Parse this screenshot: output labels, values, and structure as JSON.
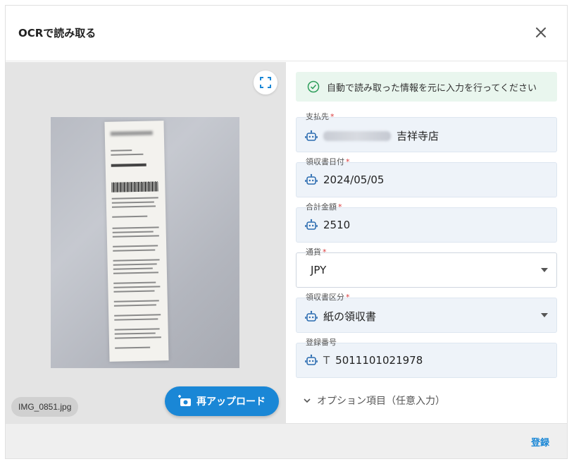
{
  "dialog": {
    "title": "OCRで読み取る",
    "close_icon": "close-icon"
  },
  "preview": {
    "expand_icon": "expand-icon",
    "file_name": "IMG_0851.jpg",
    "reupload_label": "再アップロード",
    "reupload_icon": "camera-plus-icon"
  },
  "form": {
    "notice": "自動で読み取った情報を元に入力を行ってください",
    "notice_icon": "check-circle-icon",
    "required_mark": "*",
    "fields": {
      "payee": {
        "label": "支払先",
        "value": "吉祥寺店",
        "required": true
      },
      "receipt_date": {
        "label": "領収書日付",
        "value": "2024/05/05",
        "required": true
      },
      "total_amount": {
        "label": "合計金額",
        "value": "2510",
        "required": true
      },
      "currency": {
        "label": "通貨",
        "value": "JPY",
        "required": true
      },
      "receipt_type": {
        "label": "領収書区分",
        "value": "紙の領収書",
        "required": true
      },
      "registration_number": {
        "label": "登録番号",
        "prefix": "T",
        "value": "5011101021978",
        "required": false
      }
    },
    "options_label": "オプション項目（任意入力）"
  },
  "footer": {
    "register_label": "登録"
  },
  "colors": {
    "primary": "#1a87d6",
    "notice_bg": "#e9f6ee",
    "notice_icon": "#2e9e5b",
    "auto_field_bg": "#eef3f9",
    "robot_icon": "#2b6cb0",
    "required": "#d9383a"
  }
}
